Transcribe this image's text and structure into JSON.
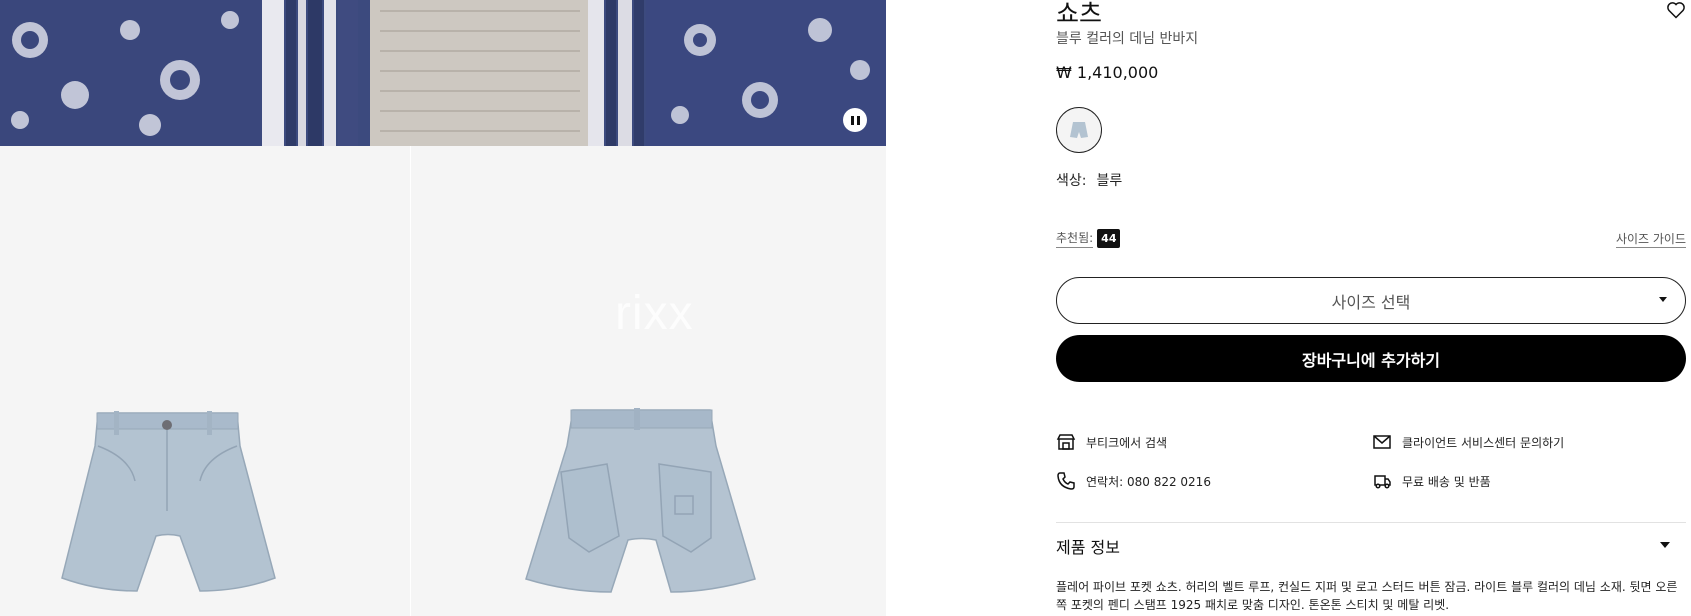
{
  "gallery": {
    "watermark": "rixx",
    "pause_icon": "pause-icon"
  },
  "product": {
    "title": "쇼츠",
    "subtitle": "블루 컬러의 데님 반바지",
    "price": "₩ 1,410,000",
    "color_label": "색상:",
    "color_value": "블루",
    "recommended_label": "추천됨:",
    "recommended_size": "44",
    "size_guide": "사이즈 가이드",
    "size_select_placeholder": "사이즈 선택",
    "add_to_cart": "장바구니에 추가하기"
  },
  "services": {
    "boutique": "부티크에서 검색",
    "contact_center": "클라이언트 서비스센터 문의하기",
    "phone": "연락처: 080 822 0216",
    "shipping": "무료 배송 및 반품"
  },
  "product_info": {
    "title": "제품 정보",
    "description": "플레어 파이브 포켓 쇼츠. 허리의 벨트 루프, 컨실드 지퍼 및 로고 스터드 버튼 잠금. 라이트 블루 컬러의 데님 소재. 뒷면 오른쪽 포켓의 펜디 스탬프 1925 패치로 맞춤 디자인. 톤온톤 스티치 및 메탈 리벳."
  },
  "colors": {
    "denim": "#b3c3d1",
    "hero_navy": "#3c4a7e",
    "button_black": "#000000"
  }
}
